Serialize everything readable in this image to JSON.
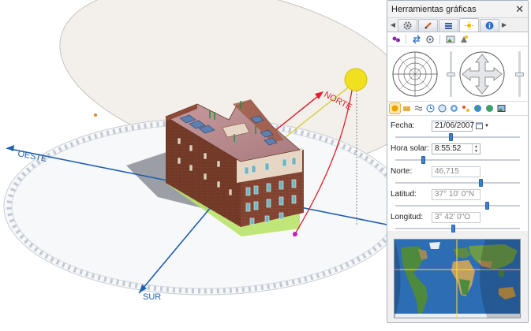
{
  "scene": {
    "labels": {
      "north": "NORTE",
      "west": "OESTE",
      "south": "SUR"
    },
    "colors": {
      "north_axis": "#e0202c",
      "sun": "#f0e020",
      "axis_blue": "#1f5fb0",
      "sky_dome": "#f1ede9"
    }
  },
  "panel": {
    "title": "Herramientas gráficas",
    "close_icon": "close-icon",
    "tabs": [
      "gear-icon",
      "pencil-icon",
      "layers-icon",
      "sun-icon",
      "info-icon"
    ],
    "active_tab": 3,
    "tool_icons": [
      "footprint-icon",
      "swap-icon",
      "refresh-icon",
      "image-icon",
      "shadow-icon"
    ],
    "mode_icons": [
      "sun-mode-icon",
      "folder-icon",
      "waves-icon",
      "clock-icon",
      "globe-icon",
      "pin-icon",
      "star-icon",
      "earth-icon",
      "sphere-icon",
      "picture-icon"
    ],
    "fields": {
      "fecha": {
        "label": "Fecha:",
        "value": "21/06/2007",
        "slider": 0.45
      },
      "hora": {
        "label": "Hora solar:",
        "value": "8:55:52",
        "slider": 0.22
      },
      "norte": {
        "label": "Norte:",
        "value": "46,715",
        "slider": 0.7
      },
      "latitud": {
        "label": "Latitud:",
        "value": "37° 10' 0\"N",
        "slider": 0.75
      },
      "longitud": {
        "label": "Longitud:",
        "value": "3° 42' 0\"O",
        "slider": 0.47
      }
    }
  }
}
